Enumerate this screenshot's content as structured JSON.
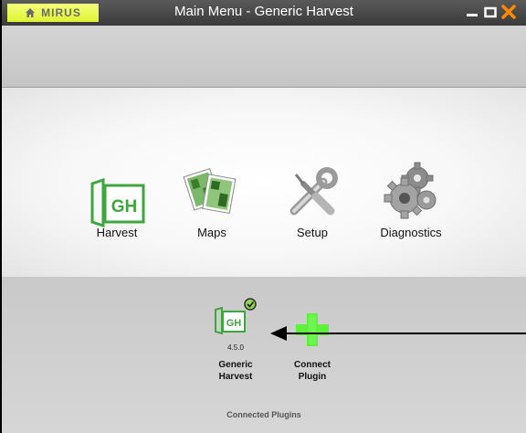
{
  "window": {
    "brand": "MIRUS",
    "title": "Main Menu - Generic Harvest"
  },
  "menu": {
    "items": [
      {
        "label": "Harvest",
        "icon": "gh-harvest-icon"
      },
      {
        "label": "Maps",
        "icon": "maps-icon"
      },
      {
        "label": "Setup",
        "icon": "wrench-screwdriver-icon"
      },
      {
        "label": "Diagnostics",
        "icon": "gears-icon"
      }
    ]
  },
  "plugins": {
    "generic_harvest": {
      "icon_text": "GH",
      "version": "4.5.0",
      "name_line1": "Generic",
      "name_line2": "Harvest"
    },
    "connect": {
      "name_line1": "Connect",
      "name_line2": "Plugin"
    },
    "section_label": "Connected Plugins"
  },
  "colors": {
    "brand_bg": "#e8f43f",
    "gh_green": "#3fa63f",
    "plus_green": "#5cf23c",
    "close_orange": "#ff8a00"
  }
}
